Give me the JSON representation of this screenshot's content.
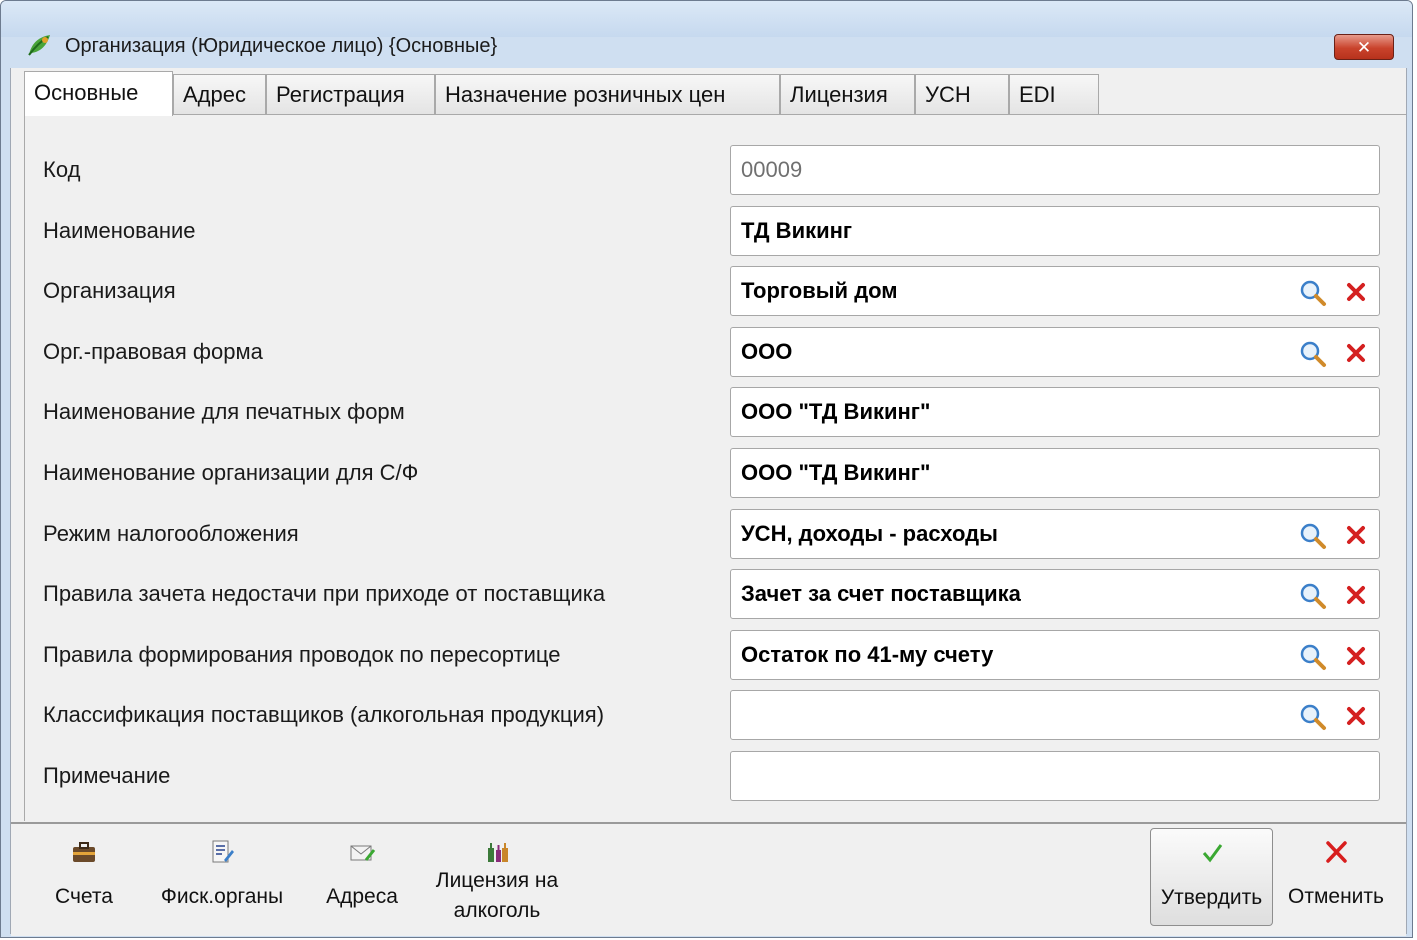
{
  "window": {
    "title": "Организация (Юридическое лицо) {Основные}"
  },
  "tabs": [
    {
      "label": "Основные",
      "active": true
    },
    {
      "label": "Адрес"
    },
    {
      "label": "Регистрация"
    },
    {
      "label": "Назначение розничных цен"
    },
    {
      "label": "Лицензия"
    },
    {
      "label": "УСН"
    },
    {
      "label": "EDI"
    }
  ],
  "form": {
    "rows": [
      {
        "label": "Код",
        "value": "00009",
        "lookup": false
      },
      {
        "label": "Наименование",
        "value": "ТД Викинг",
        "lookup": false
      },
      {
        "label": "Организация",
        "value": "Торговый дом",
        "lookup": true
      },
      {
        "label": "Орг.-правовая форма",
        "value": "ООО",
        "lookup": true
      },
      {
        "label": "Наименование для печатных форм",
        "value": "ООО \"ТД Викинг\"",
        "lookup": false
      },
      {
        "label": "Наименование организации для С/Ф",
        "value": "ООО \"ТД Викинг\"",
        "lookup": false
      },
      {
        "label": "Режим налогообложения",
        "value": "УСН, доходы - расходы",
        "lookup": true
      },
      {
        "label": "Правила зачета недостачи при приходе от поставщика",
        "value": "Зачет за счет поставщика",
        "lookup": true
      },
      {
        "label": "Правила формирования проводок по пересортице",
        "value": "Остаток по 41-му счету",
        "lookup": true
      },
      {
        "label": "Классификация поставщиков (алкогольная продукция)",
        "value": "",
        "lookup": true
      },
      {
        "label": "Примечание",
        "value": "",
        "lookup": false
      }
    ]
  },
  "toolbar": {
    "accounts_label": "Счета",
    "fiscal_label": "Фиск.органы",
    "addresses_label": "Адреса",
    "license_label_line1": "Лицензия на",
    "license_label_line2": "алкоголь",
    "confirm_label": "Утвердить",
    "cancel_label": "Отменить"
  },
  "colors": {
    "title_bar": "#c6d9ef",
    "close_button": "#c9432c",
    "confirm_check": "#3aa832",
    "cancel_cross": "#d81e1e",
    "lookup_search": "#3b7fc9",
    "lookup_clear": "#d42020"
  },
  "icons": {
    "app": "leaf-icon",
    "lookup": "magnifier-icon",
    "clear": "red-cross-icon",
    "accounts": "briefcase-icon",
    "fiscal": "document-edit-icon",
    "addresses": "envelope-icon",
    "license": "bottles-icon",
    "confirm": "checkmark-icon",
    "cancel": "cross-icon"
  }
}
